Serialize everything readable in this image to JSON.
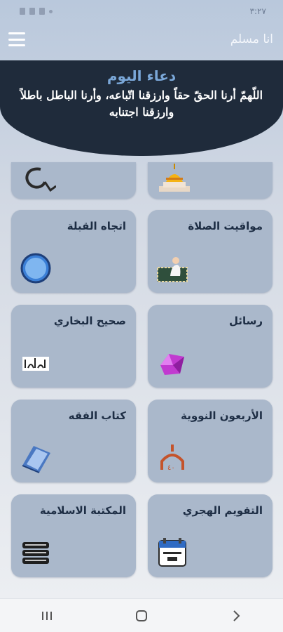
{
  "status_bar": {
    "time": "٣:٢٧"
  },
  "app_bar": {
    "title": "انا مسلم"
  },
  "dua": {
    "title": "دعاء اليوم",
    "text": "اللّهمّ أرنا الحقّ حقاً وارزقنا اتّباعه، وأرنا الباطل باطلاً وارزقنا اجتنابه"
  },
  "tiles": [
    {
      "label": "مواقيت الصلاة",
      "icon": "prayer-mat-icon"
    },
    {
      "label": "اتجاه القبلة",
      "icon": "compass-icon"
    },
    {
      "label": "رسائل",
      "icon": "message-gem-icon"
    },
    {
      "label": "صحيح البخاري",
      "icon": "bukhari-calligraphy-icon"
    },
    {
      "label": "الأربعون النووية",
      "icon": "mosque-40-icon"
    },
    {
      "label": "كتاب الفقه",
      "icon": "book-icon"
    },
    {
      "label": "التقويم الهجري",
      "icon": "calendar-icon"
    },
    {
      "label": "المكتبة الاسلامية",
      "icon": "books-stack-icon"
    }
  ],
  "partial_tiles": [
    {
      "icon": "mosque-dome-icon"
    },
    {
      "icon": "tasbih-icon"
    }
  ],
  "colors": {
    "tile": "#aab8cb",
    "dua_bg": "#1f2b3b",
    "dua_title": "#7aa7d8"
  }
}
